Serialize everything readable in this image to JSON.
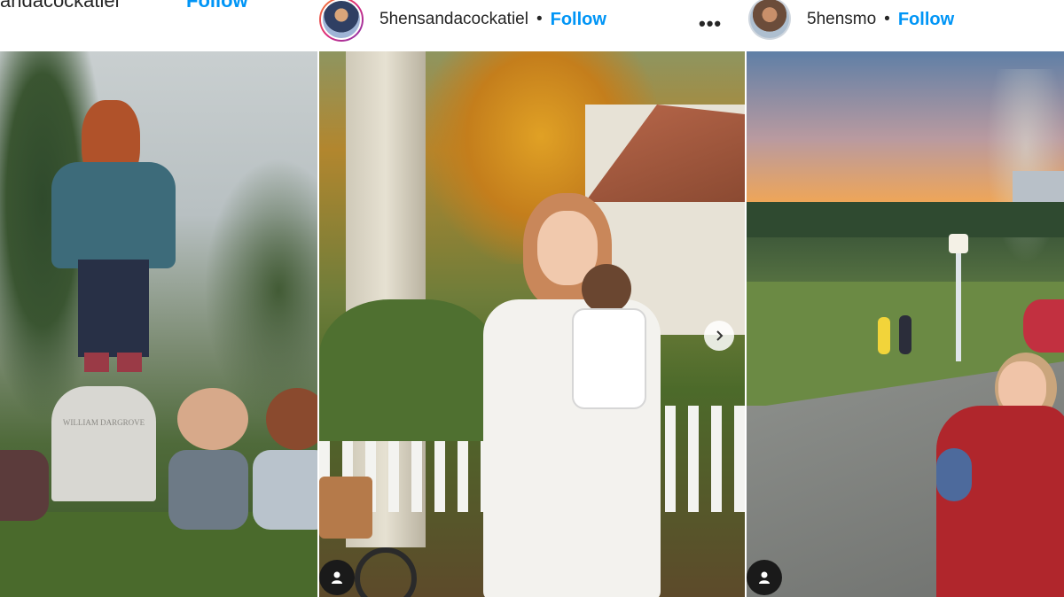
{
  "posts": [
    {
      "username_partial": "andacockatiel",
      "follow_partial": "Follow"
    },
    {
      "username": "5hensandacockatiel",
      "separator": "•",
      "follow": "Follow",
      "more": "•••"
    },
    {
      "username": "5hensmo",
      "separator": "•",
      "follow": "Follow"
    }
  ],
  "photo1": {
    "gravestone_text": "WILLIAM DARGROVE"
  },
  "icons": {
    "user_tag": "person-icon",
    "next": "chevron-right-icon",
    "more": "more-options-icon"
  }
}
